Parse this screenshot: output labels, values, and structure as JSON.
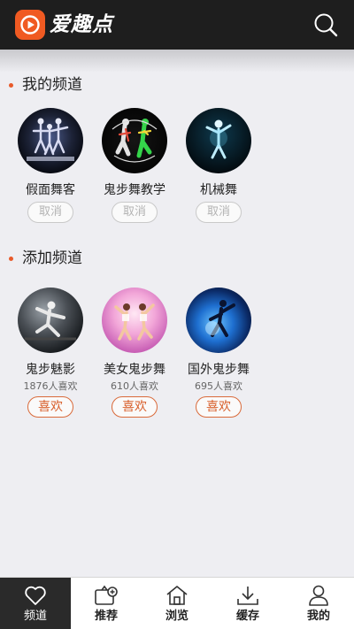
{
  "header": {
    "app_name": "爱趣点",
    "logo_icon": "play-logo-icon",
    "search_icon": "search-icon",
    "brand_color": "#f05a22"
  },
  "my_channels": {
    "title": "我的频道",
    "items": [
      {
        "name": "假面舞客",
        "button": "取消"
      },
      {
        "name": "鬼步舞教学",
        "button": "取消"
      },
      {
        "name": "机械舞",
        "button": "取消"
      }
    ]
  },
  "add_channels": {
    "title": "添加频道",
    "items": [
      {
        "name": "鬼步魅影",
        "likes": "1876人喜欢",
        "button": "喜欢"
      },
      {
        "name": "美女鬼步舞",
        "likes": "610人喜欢",
        "button": "喜欢"
      },
      {
        "name": "国外鬼步舞",
        "likes": "695人喜欢",
        "button": "喜欢"
      }
    ]
  },
  "bottom_nav": {
    "items": [
      {
        "label": "频道",
        "icon": "heart-icon",
        "active": true
      },
      {
        "label": "推荐",
        "icon": "recommend-icon",
        "active": false
      },
      {
        "label": "浏览",
        "icon": "home-icon",
        "active": false
      },
      {
        "label": "缓存",
        "icon": "download-icon",
        "active": false
      },
      {
        "label": "我的",
        "icon": "user-icon",
        "active": false
      }
    ]
  },
  "colors": {
    "accent": "#e85a2a",
    "like_text": "#d8602c",
    "header_bg": "#1e1e1e",
    "page_bg": "#eeeef2"
  }
}
